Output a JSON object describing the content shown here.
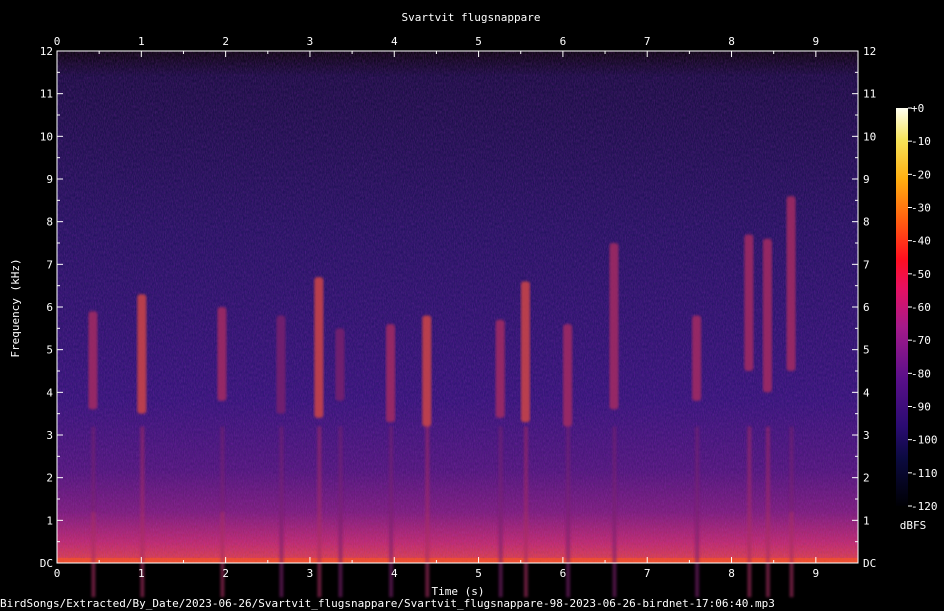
{
  "chart_data": {
    "type": "heatmap",
    "title": "Svartvit flugsnappare",
    "xlabel": "Time (s)",
    "ylabel": "Frequency (kHz)",
    "xlim": [
      0,
      9.5
    ],
    "ylim": [
      0,
      12
    ],
    "x_ticks": [
      "0",
      "1",
      "2",
      "3",
      "4",
      "5",
      "6",
      "7",
      "8",
      "9"
    ],
    "y_ticks": [
      "DC",
      "1",
      "2",
      "3",
      "4",
      "5",
      "6",
      "7",
      "8",
      "9",
      "10",
      "11",
      "12"
    ],
    "colorbar": {
      "label": "dBFS",
      "range": [
        -120,
        0
      ],
      "ticks": [
        "+0",
        "-10",
        "-20",
        "-30",
        "-40",
        "-50",
        "-60",
        "-70",
        "-80",
        "-90",
        "-100",
        "-110",
        "-120"
      ],
      "colormap": [
        "#000004",
        "#1b0c41",
        "#4a0c6b",
        "#781c6d",
        "#a52c60",
        "#cf4446",
        "#ed6925",
        "#fb9b06",
        "#f7d13d",
        "#fcffa4"
      ]
    },
    "calls": [
      {
        "t": 0.42,
        "f_low": 3.6,
        "f_high": 5.9,
        "level_dbfs": -65
      },
      {
        "t": 1.0,
        "f_low": 3.5,
        "f_high": 6.3,
        "level_dbfs": -60
      },
      {
        "t": 1.95,
        "f_low": 3.8,
        "f_high": 6.0,
        "level_dbfs": -65
      },
      {
        "t": 2.65,
        "f_low": 3.5,
        "f_high": 5.8,
        "level_dbfs": -75
      },
      {
        "t": 3.1,
        "f_low": 3.4,
        "f_high": 6.7,
        "level_dbfs": -60
      },
      {
        "t": 3.35,
        "f_low": 3.8,
        "f_high": 5.5,
        "level_dbfs": -75
      },
      {
        "t": 3.95,
        "f_low": 3.3,
        "f_high": 5.6,
        "level_dbfs": -70
      },
      {
        "t": 4.38,
        "f_low": 3.2,
        "f_high": 5.8,
        "level_dbfs": -60
      },
      {
        "t": 5.25,
        "f_low": 3.4,
        "f_high": 5.7,
        "level_dbfs": -72
      },
      {
        "t": 5.55,
        "f_low": 3.3,
        "f_high": 6.6,
        "level_dbfs": -58
      },
      {
        "t": 6.05,
        "f_low": 3.2,
        "f_high": 5.6,
        "level_dbfs": -70
      },
      {
        "t": 6.6,
        "f_low": 3.6,
        "f_high": 7.5,
        "level_dbfs": -68
      },
      {
        "t": 7.58,
        "f_low": 3.8,
        "f_high": 5.8,
        "level_dbfs": -70
      },
      {
        "t": 8.2,
        "f_low": 4.5,
        "f_high": 7.7,
        "level_dbfs": -62
      },
      {
        "t": 8.42,
        "f_low": 4.0,
        "f_high": 7.6,
        "level_dbfs": -62
      },
      {
        "t": 8.7,
        "f_low": 4.5,
        "f_high": 8.6,
        "level_dbfs": -65
      }
    ]
  },
  "footer_path": "BirdSongs/Extracted/By_Date/2023-06-26/Svartvit_flugsnappare/Svartvit_flugsnappare-98-2023-06-26-birdnet-17:06:40.mp3"
}
